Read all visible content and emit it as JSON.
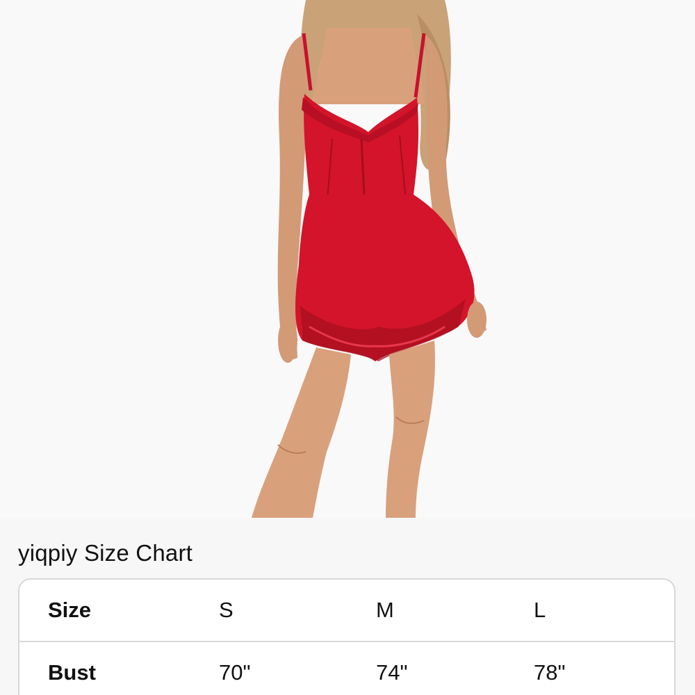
{
  "product_image": {
    "description_icon": "red-lace-mini-dress-photo",
    "dress_color": "#d4142a",
    "dress_shadow": "#a50e1f",
    "skin_color": "#d9a07c",
    "hair_color": "#c9a278"
  },
  "size_chart": {
    "title": "yiqpiy Size Chart",
    "header": {
      "label": "Size",
      "values": [
        "S",
        "M",
        "L"
      ]
    },
    "rows": [
      {
        "label": "Bust",
        "values": [
          "70\"",
          "74\"",
          "78\""
        ]
      }
    ]
  }
}
